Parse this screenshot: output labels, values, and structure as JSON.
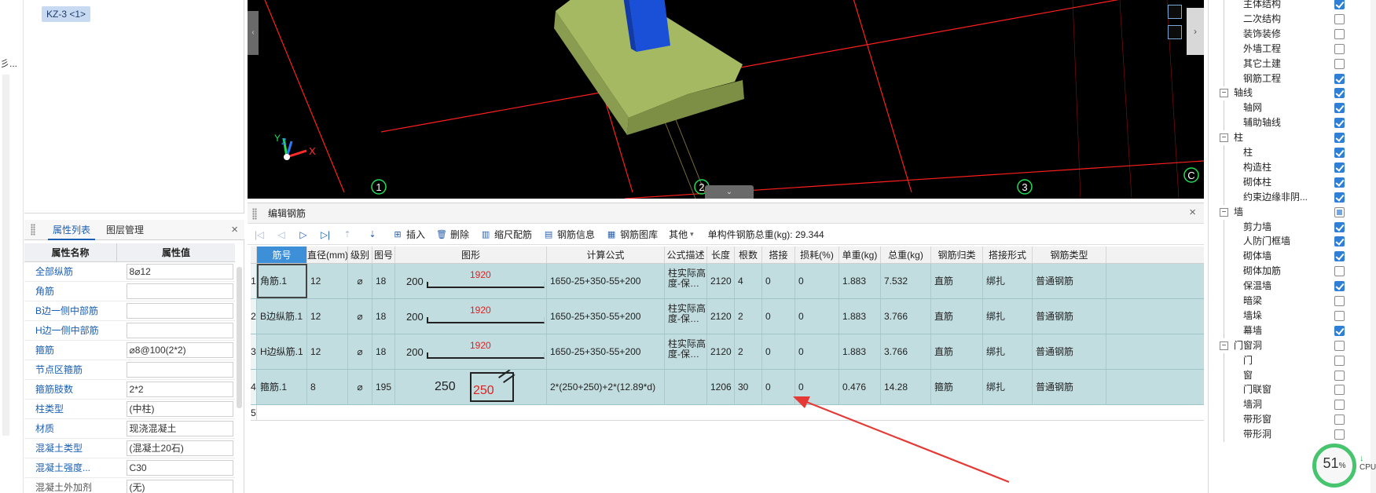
{
  "left_strip": {
    "text": "彡..."
  },
  "component_tree": {
    "selected_tag": "KZ-3 <1>"
  },
  "properties": {
    "tabs": [
      "属性列表",
      "图层管理"
    ],
    "header": {
      "name": "属性名称",
      "value": "属性值"
    },
    "rows": [
      {
        "name": "全部纵筋",
        "value": "8⌀12"
      },
      {
        "name": "角筋",
        "value": ""
      },
      {
        "name": "B边一侧中部筋",
        "value": ""
      },
      {
        "name": "H边一侧中部筋",
        "value": ""
      },
      {
        "name": "箍筋",
        "value": "⌀8@100(2*2)"
      },
      {
        "name": "节点区箍筋",
        "value": ""
      },
      {
        "name": "箍筋肢数",
        "value": "2*2"
      },
      {
        "name": "柱类型",
        "value": "(中柱)"
      },
      {
        "name": "材质",
        "value": "现浇混凝土"
      },
      {
        "name": "混凝土类型",
        "value": "(混凝土20石)"
      },
      {
        "name": "混凝土强度...",
        "value": "C30"
      },
      {
        "name": "混凝土外加剂",
        "value": "(无)"
      }
    ]
  },
  "viewport": {
    "axis_labels": [
      "1",
      "2",
      "3",
      "C"
    ],
    "coord_labels": {
      "x": "X",
      "y": "Y",
      "z": "Z"
    }
  },
  "editor": {
    "title": "编辑钢筋",
    "toolbar": {
      "insert": "插入",
      "delete": "删除",
      "scale": "缩尺配筋",
      "info": "钢筋信息",
      "library": "钢筋图库",
      "other": "其他",
      "total_weight": "单构件钢筋总重(kg): 29.344"
    },
    "columns": [
      "筋号",
      "直径(mm)",
      "级别",
      "图号",
      "图形",
      "计算公式",
      "公式描述",
      "长度",
      "根数",
      "搭接",
      "损耗(%)",
      "单重(kg)",
      "总重(kg)",
      "钢筋归类",
      "搭接形式",
      "钢筋类型"
    ],
    "rows": [
      {
        "no": "1",
        "name": "角筋.1",
        "dia": "12",
        "grade": "⌀",
        "fig": "18",
        "shape_left": "200",
        "shape_top": "1920",
        "formula": "1650-25+350-55+200",
        "desc": "柱实际高度-保…",
        "len": "2120",
        "count": "4",
        "lap": "0",
        "loss": "0",
        "unit_w": "1.883",
        "total_w": "7.532",
        "category": "直筋",
        "lap_type": "绑扎",
        "rebar_type": "普通钢筋"
      },
      {
        "no": "2",
        "name": "B边纵筋.1",
        "dia": "12",
        "grade": "⌀",
        "fig": "18",
        "shape_left": "200",
        "shape_top": "1920",
        "formula": "1650-25+350-55+200",
        "desc": "柱实际高度-保…",
        "len": "2120",
        "count": "2",
        "lap": "0",
        "loss": "0",
        "unit_w": "1.883",
        "total_w": "3.766",
        "category": "直筋",
        "lap_type": "绑扎",
        "rebar_type": "普通钢筋"
      },
      {
        "no": "3",
        "name": "H边纵筋.1",
        "dia": "12",
        "grade": "⌀",
        "fig": "18",
        "shape_left": "200",
        "shape_top": "1920",
        "formula": "1650-25+350-55+200",
        "desc": "柱实际高度-保…",
        "len": "2120",
        "count": "2",
        "lap": "0",
        "loss": "0",
        "unit_w": "1.883",
        "total_w": "3.766",
        "category": "直筋",
        "lap_type": "绑扎",
        "rebar_type": "普通钢筋"
      },
      {
        "no": "4",
        "name": "箍筋.1",
        "dia": "8",
        "grade": "⌀",
        "fig": "195",
        "shape_left": "250",
        "shape_top": "250",
        "formula": "2*(250+250)+2*(12.89*d)",
        "desc": "",
        "len": "1206",
        "count": "30",
        "lap": "0",
        "loss": "0",
        "unit_w": "0.476",
        "total_w": "14.28",
        "category": "箍筋",
        "lap_type": "绑扎",
        "rebar_type": "普通钢筋"
      }
    ],
    "empty_row_no": "5"
  },
  "layers": [
    {
      "label": "主体结构",
      "level": 2,
      "state": "on"
    },
    {
      "label": "二次结构",
      "level": 2,
      "state": "off"
    },
    {
      "label": "装饰装修",
      "level": 2,
      "state": "off"
    },
    {
      "label": "外墙工程",
      "level": 2,
      "state": "off"
    },
    {
      "label": "其它土建",
      "level": 2,
      "state": "off"
    },
    {
      "label": "钢筋工程",
      "level": 2,
      "state": "on"
    },
    {
      "label": "轴线",
      "level": 1,
      "state": "on"
    },
    {
      "label": "轴网",
      "level": 2,
      "state": "on"
    },
    {
      "label": "辅助轴线",
      "level": 2,
      "state": "on"
    },
    {
      "label": "柱",
      "level": 1,
      "state": "on"
    },
    {
      "label": "柱",
      "level": 2,
      "state": "on"
    },
    {
      "label": "构造柱",
      "level": 2,
      "state": "on"
    },
    {
      "label": "砌体柱",
      "level": 2,
      "state": "on"
    },
    {
      "label": "约束边缘非阴...",
      "level": 2,
      "state": "on"
    },
    {
      "label": "墙",
      "level": 1,
      "state": "partial"
    },
    {
      "label": "剪力墙",
      "level": 2,
      "state": "on"
    },
    {
      "label": "人防门框墙",
      "level": 2,
      "state": "on"
    },
    {
      "label": "砌体墙",
      "level": 2,
      "state": "on"
    },
    {
      "label": "砌体加筋",
      "level": 2,
      "state": "off"
    },
    {
      "label": "保温墙",
      "level": 2,
      "state": "on"
    },
    {
      "label": "暗梁",
      "level": 2,
      "state": "off"
    },
    {
      "label": "墙垛",
      "level": 2,
      "state": "off"
    },
    {
      "label": "幕墙",
      "level": 2,
      "state": "on"
    },
    {
      "label": "门窗洞",
      "level": 1,
      "state": "off"
    },
    {
      "label": "门",
      "level": 2,
      "state": "off"
    },
    {
      "label": "窗",
      "level": 2,
      "state": "off"
    },
    {
      "label": "门联窗",
      "level": 2,
      "state": "off"
    },
    {
      "label": "墙洞",
      "level": 2,
      "state": "off"
    },
    {
      "label": "带形窗",
      "level": 2,
      "state": "off"
    },
    {
      "label": "带形洞",
      "level": 2,
      "state": "off"
    }
  ],
  "cpu": {
    "value": "51",
    "unit": "%",
    "label": "CPU"
  },
  "colors": {
    "accent": "#1a5fb4",
    "row_fill": "#c2dde0",
    "annotation": "#e53935"
  }
}
